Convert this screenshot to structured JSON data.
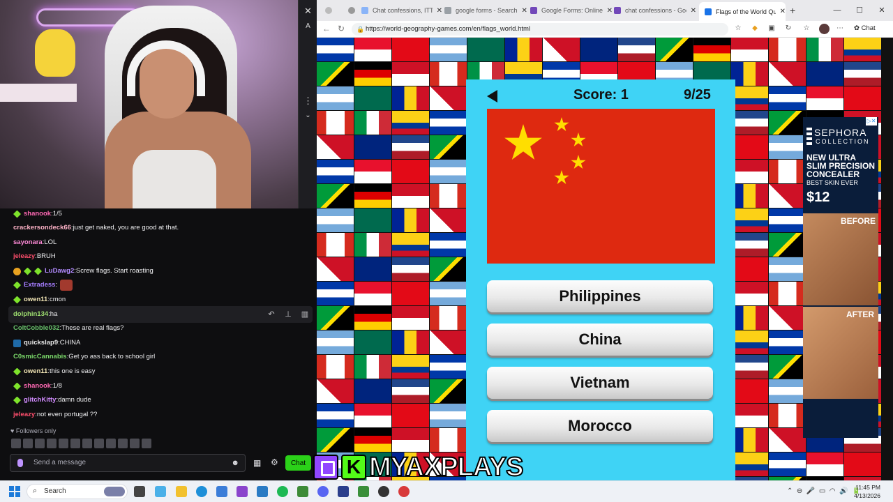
{
  "browser": {
    "tabs": [
      {
        "label": "Chat confessions, ITTS",
        "color": "#8ab4f8"
      },
      {
        "label": "google forms - Search",
        "color": "#9aa0a6"
      },
      {
        "label": "Google Forms: Online",
        "color": "#7248b9"
      },
      {
        "label": "chat confessions - Goo",
        "color": "#7248b9"
      },
      {
        "label": "Flags of the World Qui",
        "color": "#1a73e8",
        "active": true
      }
    ],
    "new_tab": "+",
    "url": "https://world-geography-games.com/en/flags_world.html",
    "chat_label": "Chat"
  },
  "game": {
    "score_label": "Score: 1",
    "progress_label": "9/25",
    "flag_icon": "china-flag",
    "answers": [
      "Philippines",
      "China",
      "Vietnam",
      "Morocco"
    ]
  },
  "ad": {
    "brand": "SEPHORA",
    "brand_sub": "COLLECTION",
    "headline": "NEW ULTRA SLIM PRECISION CONCEALER",
    "subline": "BEST SKIN EVER",
    "price": "$12",
    "before": "BEFORE",
    "after": "AFTER"
  },
  "chat": {
    "messages": [
      {
        "user": "shanook",
        "text": "1/5",
        "color": "#ff69b4",
        "badges": [
          "diamond"
        ]
      },
      {
        "user": "crackersondeck66",
        "text": "just get naked, you are good at that.",
        "color": "#ffb3c8",
        "badges": []
      },
      {
        "user": "sayonara",
        "text": "LOL",
        "color": "#ff8ad8",
        "badges": []
      },
      {
        "user": "jeleazy",
        "text": "BRUH",
        "color": "#ff4f6d",
        "badges": []
      },
      {
        "user": "LuDawg2",
        "text": "Screw flags. Start roasting",
        "color": "#b28bff",
        "badges": [
          "coin",
          "diamond",
          "diamond"
        ]
      },
      {
        "user": "Extradess",
        "text": "",
        "color": "#a57dff",
        "badges": [
          "diamond"
        ],
        "emote": true
      },
      {
        "user": "owen11",
        "text": "cmon",
        "color": "#f2e6b5",
        "badges": [
          "diamond"
        ]
      },
      {
        "user": "dolphin134",
        "text": "ha",
        "color": "#9ddd6f",
        "badges": []
      },
      {
        "user": "ColtCobble032",
        "text": "These are real flags?",
        "color": "#68c26b",
        "badges": []
      },
      {
        "user": "quickslap9",
        "text": "CHINA",
        "color": "#e8e8e8",
        "badges": [
          "bolt"
        ]
      },
      {
        "user": "C0smicCannabis",
        "text": "Get yo ass back to school girl",
        "color": "#7bd96a",
        "badges": []
      },
      {
        "user": "owen11",
        "text": "this one is easy",
        "color": "#f2e6b5",
        "badges": [
          "diamond"
        ]
      },
      {
        "user": "shanook",
        "text": "1/8",
        "color": "#ff69b4",
        "badges": [
          "diamond"
        ]
      },
      {
        "user": "glitchKitty",
        "text": "damn dude",
        "color": "#d28cff",
        "badges": [
          "diamond"
        ]
      },
      {
        "user": "jeleazy",
        "text": "not even portugal ??",
        "color": "#ff4f6d",
        "badges": []
      }
    ],
    "followers_only": "Followers only",
    "input_placeholder": "Send a message",
    "send_label": "Chat"
  },
  "overlay": {
    "streamer_name": "MYAXPLAYS"
  },
  "taskbar": {
    "search_label": "Search",
    "time": "11:45 PM",
    "date": "4/13/2026"
  }
}
